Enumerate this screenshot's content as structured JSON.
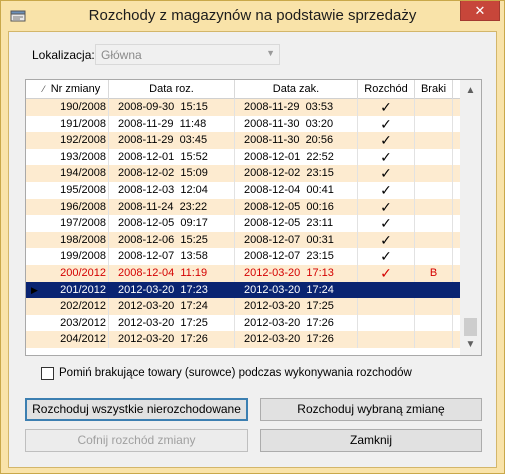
{
  "window": {
    "title": "Rozchody z magazynów na podstawie sprzedaży",
    "close_label": "✕"
  },
  "location": {
    "label": "Lokalizacja:",
    "value": "Główna"
  },
  "grid": {
    "columns": [
      "Nr zmiany",
      "Data roz.",
      "Data zak.",
      "Rozchód",
      "Braki"
    ],
    "sort_marker": "⁄",
    "row_pointer": "▶",
    "rows": [
      {
        "nr": "190/2008",
        "data_roz": "2008-09-30  15:15",
        "data_zak": "2008-11-29  03:53",
        "rozchod": "✓",
        "braki": ""
      },
      {
        "nr": "191/2008",
        "data_roz": "2008-11-29  11:48",
        "data_zak": "2008-11-30  03:20",
        "rozchod": "✓",
        "braki": ""
      },
      {
        "nr": "192/2008",
        "data_roz": "2008-11-29  03:45",
        "data_zak": "2008-11-30  20:56",
        "rozchod": "✓",
        "braki": ""
      },
      {
        "nr": "193/2008",
        "data_roz": "2008-12-01  15:52",
        "data_zak": "2008-12-01  22:52",
        "rozchod": "✓",
        "braki": ""
      },
      {
        "nr": "194/2008",
        "data_roz": "2008-12-02  15:09",
        "data_zak": "2008-12-02  23:15",
        "rozchod": "✓",
        "braki": ""
      },
      {
        "nr": "195/2008",
        "data_roz": "2008-12-03  12:04",
        "data_zak": "2008-12-04  00:41",
        "rozchod": "✓",
        "braki": ""
      },
      {
        "nr": "196/2008",
        "data_roz": "2008-11-24  23:22",
        "data_zak": "2008-12-05  00:16",
        "rozchod": "✓",
        "braki": ""
      },
      {
        "nr": "197/2008",
        "data_roz": "2008-12-05  09:17",
        "data_zak": "2008-12-05  23:11",
        "rozchod": "✓",
        "braki": ""
      },
      {
        "nr": "198/2008",
        "data_roz": "2008-12-06  15:25",
        "data_zak": "2008-12-07  00:31",
        "rozchod": "✓",
        "braki": ""
      },
      {
        "nr": "199/2008",
        "data_roz": "2008-12-07  13:58",
        "data_zak": "2008-12-07  23:15",
        "rozchod": "✓",
        "braki": ""
      },
      {
        "nr": "200/2012",
        "data_roz": "2008-12-04  11:19",
        "data_zak": "2012-03-20  17:13",
        "rozchod": "✓",
        "braki": "B"
      },
      {
        "nr": "201/2012",
        "data_roz": "2012-03-20  17:23",
        "data_zak": "2012-03-20  17:24",
        "rozchod": "",
        "braki": ""
      },
      {
        "nr": "202/2012",
        "data_roz": "2012-03-20  17:24",
        "data_zak": "2012-03-20  17:25",
        "rozchod": "",
        "braki": ""
      },
      {
        "nr": "203/2012",
        "data_roz": "2012-03-20  17:25",
        "data_zak": "2012-03-20  17:26",
        "rozchod": "",
        "braki": ""
      },
      {
        "nr": "204/2012",
        "data_roz": "2012-03-20  17:26",
        "data_zak": "2012-03-20  17:26",
        "rozchod": "",
        "braki": ""
      }
    ],
    "scroll_up": "▲",
    "scroll_down": "▼"
  },
  "options": {
    "skip_missing_label": "Pomiń brakujące towary (surowce) podczas wykonywania rozchodów",
    "skip_missing_checked": false
  },
  "buttons": {
    "issue_all": "Rozchoduj wszystkie nierozchodowane",
    "issue_selected": "Rozchoduj wybraną zmianę",
    "undo_issue": "Cofnij rozchód zmiany",
    "close": "Zamknij"
  },
  "colors": {
    "frame": "#f9e3a9",
    "row_alt": "#fdebd0",
    "selected_row": "#0a2472",
    "warning_text": "#d40000"
  }
}
